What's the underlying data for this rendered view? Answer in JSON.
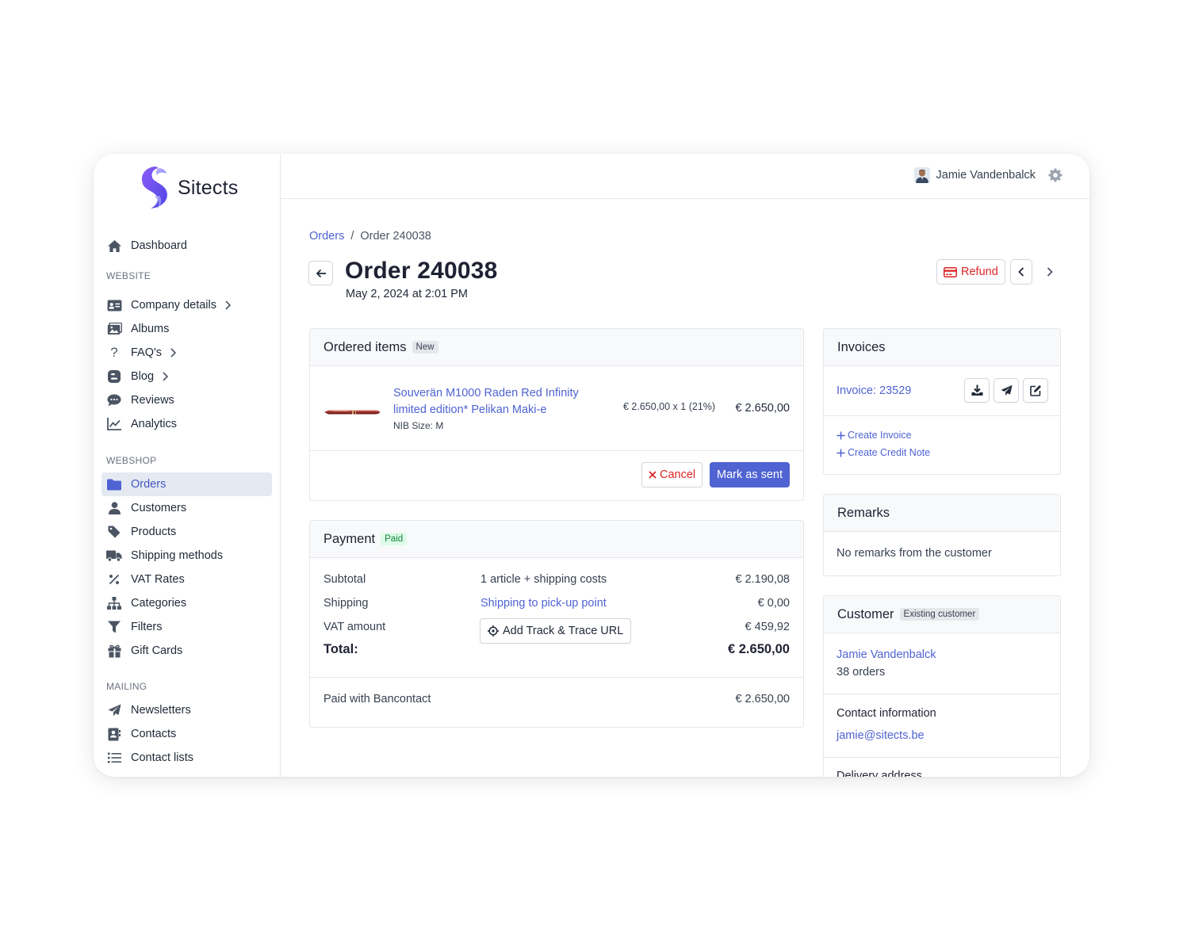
{
  "brand": {
    "name": "Sitects"
  },
  "sidebar": {
    "top": [
      {
        "label": "Dashboard",
        "icon": "home-icon"
      }
    ],
    "sections": [
      {
        "title": "WEBSITE",
        "items": [
          {
            "label": "Company details",
            "icon": "id-card-icon",
            "chevron": true
          },
          {
            "label": "Albums",
            "icon": "images-icon"
          },
          {
            "label": "FAQ's",
            "icon": "question-icon",
            "chevron": true
          },
          {
            "label": "Blog",
            "icon": "blog-icon",
            "chevron": true
          },
          {
            "label": "Reviews",
            "icon": "comments-icon"
          },
          {
            "label": "Analytics",
            "icon": "chart-line-icon"
          }
        ]
      },
      {
        "title": "WEBSHOP",
        "items": [
          {
            "label": "Orders",
            "icon": "folder-icon",
            "active": true
          },
          {
            "label": "Customers",
            "icon": "user-icon"
          },
          {
            "label": "Products",
            "icon": "tag-icon"
          },
          {
            "label": "Shipping methods",
            "icon": "truck-icon"
          },
          {
            "label": "VAT Rates",
            "icon": "percent-icon"
          },
          {
            "label": "Categories",
            "icon": "sitemap-icon"
          },
          {
            "label": "Filters",
            "icon": "filter-icon"
          },
          {
            "label": "Gift Cards",
            "icon": "gift-icon"
          }
        ]
      },
      {
        "title": "MAILING",
        "items": [
          {
            "label": "Newsletters",
            "icon": "paper-plane-icon"
          },
          {
            "label": "Contacts",
            "icon": "address-book-icon"
          },
          {
            "label": "Contact lists",
            "icon": "list-icon"
          }
        ]
      }
    ]
  },
  "topbar": {
    "user_name": "Jamie Vandenbalck"
  },
  "breadcrumb": {
    "parent": "Orders",
    "separator": "/",
    "current": "Order 240038"
  },
  "header": {
    "title": "Order 240038",
    "date": "May 2, 2024 at 2:01 PM",
    "refund_label": "Refund"
  },
  "ordered_items": {
    "title": "Ordered items",
    "badge": "New",
    "items": [
      {
        "name": "Souverän M1000 Raden Red Infinity limited edition* Pelikan Maki-e",
        "option": "NIB Size:  M",
        "unit_price": "€ 2.650,00 x 1 (21%)",
        "total": "€ 2.650,00"
      }
    ],
    "cancel_label": "Cancel",
    "mark_sent_label": "Mark as sent"
  },
  "payment": {
    "title": "Payment",
    "badge": "Paid",
    "rows": {
      "subtotal_label": "Subtotal",
      "subtotal_desc": "1 article + shipping costs",
      "subtotal_value": "€ 2.190,08",
      "shipping_label": "Shipping",
      "shipping_desc": "Shipping to pick-up point",
      "shipping_value": "€ 0,00",
      "vat_label": "VAT amount",
      "vat_value": "€ 459,92",
      "total_label": "Total:",
      "total_value": "€ 2.650,00"
    },
    "track_label": "Add Track & Trace URL",
    "paid_with": "Paid with Bancontact",
    "paid_amount": "€ 2.650,00"
  },
  "invoices": {
    "title": "Invoices",
    "invoice_label": "Invoice: 23529",
    "create_invoice": "Create Invoice",
    "create_credit_note": "Create Credit Note"
  },
  "remarks": {
    "title": "Remarks",
    "text": "No remarks from the customer"
  },
  "customer": {
    "title": "Customer",
    "badge": "Existing customer",
    "name": "Jamie Vandenbalck",
    "orders": "38 orders",
    "contact_title": "Contact information",
    "email": "jamie@sitects.be",
    "delivery_title": "Delivery address"
  },
  "colors": {
    "accent": "#4f63d2",
    "danger": "#dc2626",
    "success_bg": "#dcfce7",
    "success_text": "#15803d"
  }
}
